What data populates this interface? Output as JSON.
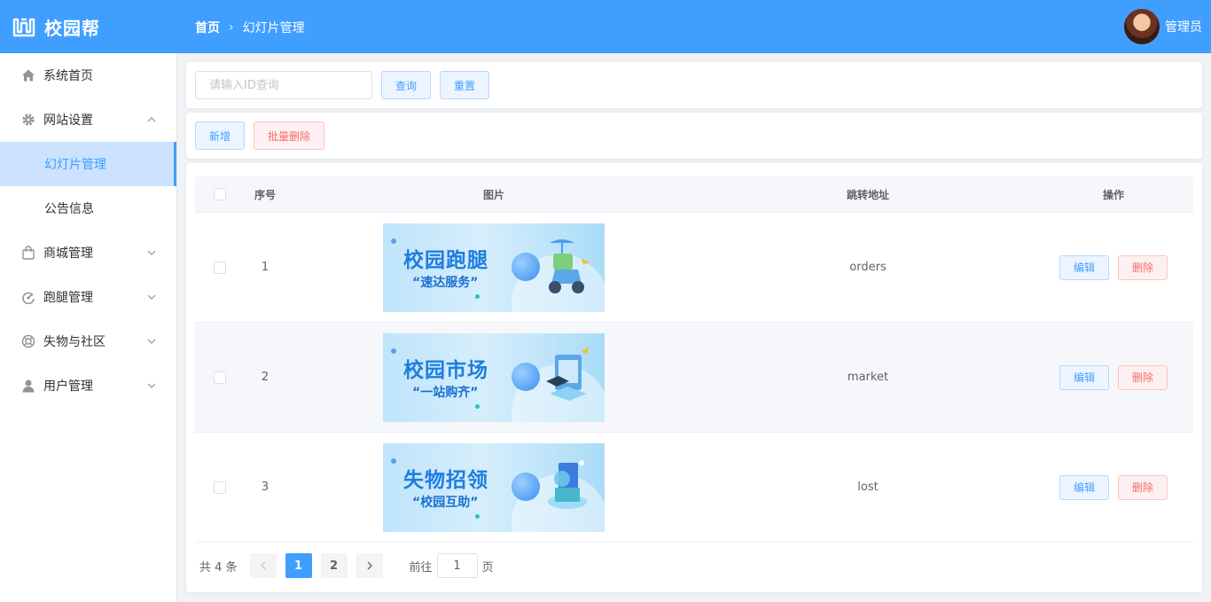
{
  "header": {
    "app_name": "校园帮",
    "breadcrumb": [
      "首页",
      "幻灯片管理"
    ],
    "user_name": "管理员",
    "color": "#409eff"
  },
  "sidebar": {
    "items": [
      {
        "label": "系统首页",
        "icon": "home-icon"
      },
      {
        "label": "网站设置",
        "icon": "gear-icon",
        "expanded": true
      },
      {
        "label": "幻灯片管理",
        "sub": true,
        "active": true
      },
      {
        "label": "公告信息",
        "sub": true
      },
      {
        "label": "商城管理",
        "icon": "shopping-bag-icon"
      },
      {
        "label": "跑腿管理",
        "icon": "gauge-icon"
      },
      {
        "label": "失物与社区",
        "icon": "lifebuoy-icon"
      },
      {
        "label": "用户管理",
        "icon": "user-icon"
      }
    ]
  },
  "search": {
    "placeholder": "请输入ID查询",
    "query_label": "查询",
    "reset_label": "重置"
  },
  "actions": {
    "add_label": "新增",
    "batch_delete_label": "批量删除"
  },
  "table": {
    "headers": {
      "no": "序号",
      "image": "图片",
      "url": "跳转地址",
      "ops": "操作"
    },
    "rows": [
      {
        "no": "1",
        "banner_title": "校园跑腿",
        "banner_sub": "“速达服务”",
        "url": "orders",
        "edit": "编辑",
        "delete": "删除"
      },
      {
        "no": "2",
        "banner_title": "校园市场",
        "banner_sub": "“一站购齐”",
        "url": "market",
        "edit": "编辑",
        "delete": "删除"
      },
      {
        "no": "3",
        "banner_title": "失物招领",
        "banner_sub": "“校园互助”",
        "url": "lost",
        "edit": "编辑",
        "delete": "删除"
      }
    ]
  },
  "pagination": {
    "total_text": "共 4 条",
    "pages": [
      "1",
      "2"
    ],
    "current": "1",
    "goto_prefix": "前往",
    "goto_value": "1",
    "goto_suffix": "页"
  }
}
